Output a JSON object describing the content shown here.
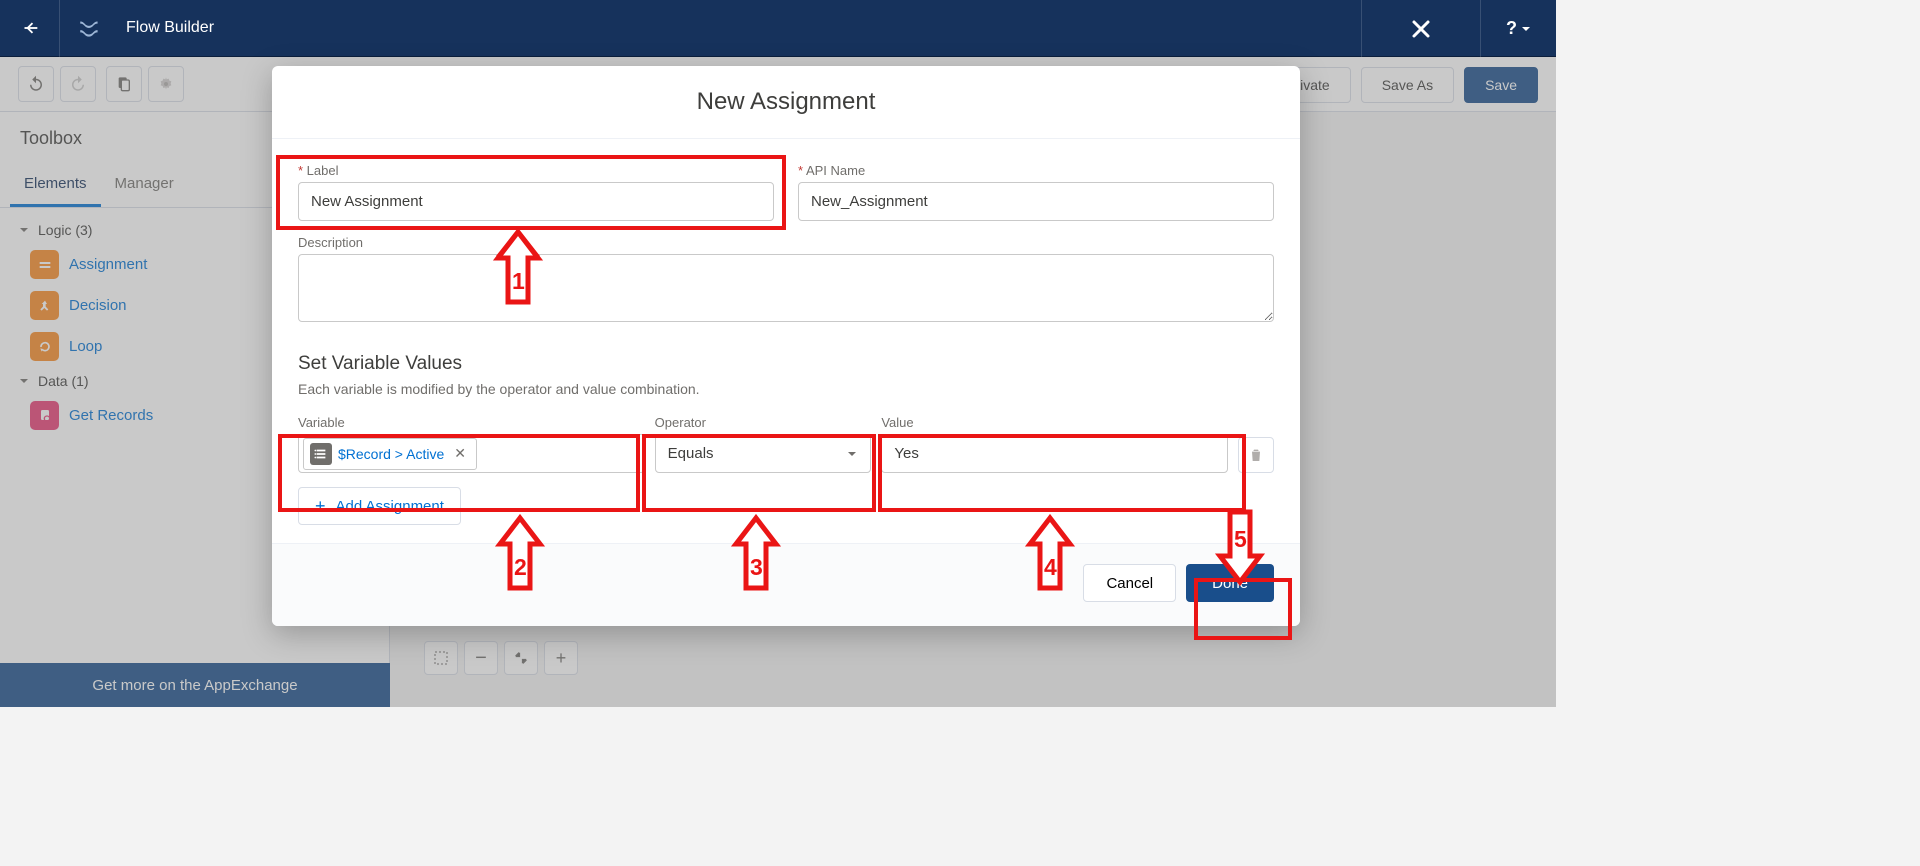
{
  "header": {
    "title": "Flow Builder"
  },
  "subtoolbar": {
    "activate": "Activate",
    "save_as": "Save As",
    "save": "Save"
  },
  "toolbox": {
    "title": "Toolbox",
    "tabs": {
      "elements": "Elements",
      "manager": "Manager"
    },
    "logic_label": "Logic (3)",
    "data_label": "Data (1)",
    "items": {
      "assignment": "Assignment",
      "decision": "Decision",
      "loop": "Loop",
      "get_records": "Get Records"
    },
    "get_more": "Get more on the AppExchange"
  },
  "modal": {
    "title": "New Assignment",
    "label_field": "Label",
    "api_name_field": "API Name",
    "label_value": "New Assignment",
    "api_name_value": "New_Assignment",
    "description_field": "Description",
    "section_head": "Set Variable Values",
    "section_sub": "Each variable is modified by the operator and value combination.",
    "col_variable": "Variable",
    "col_operator": "Operator",
    "col_value": "Value",
    "variable_pill": "$Record > Active",
    "operator_value": "Equals",
    "value_value": "Yes",
    "add_assignment": "Add Assignment",
    "cancel": "Cancel",
    "done": "Done"
  },
  "annotations": {
    "n1": "1",
    "n2": "2",
    "n3": "3",
    "n4": "4",
    "n5": "5"
  }
}
